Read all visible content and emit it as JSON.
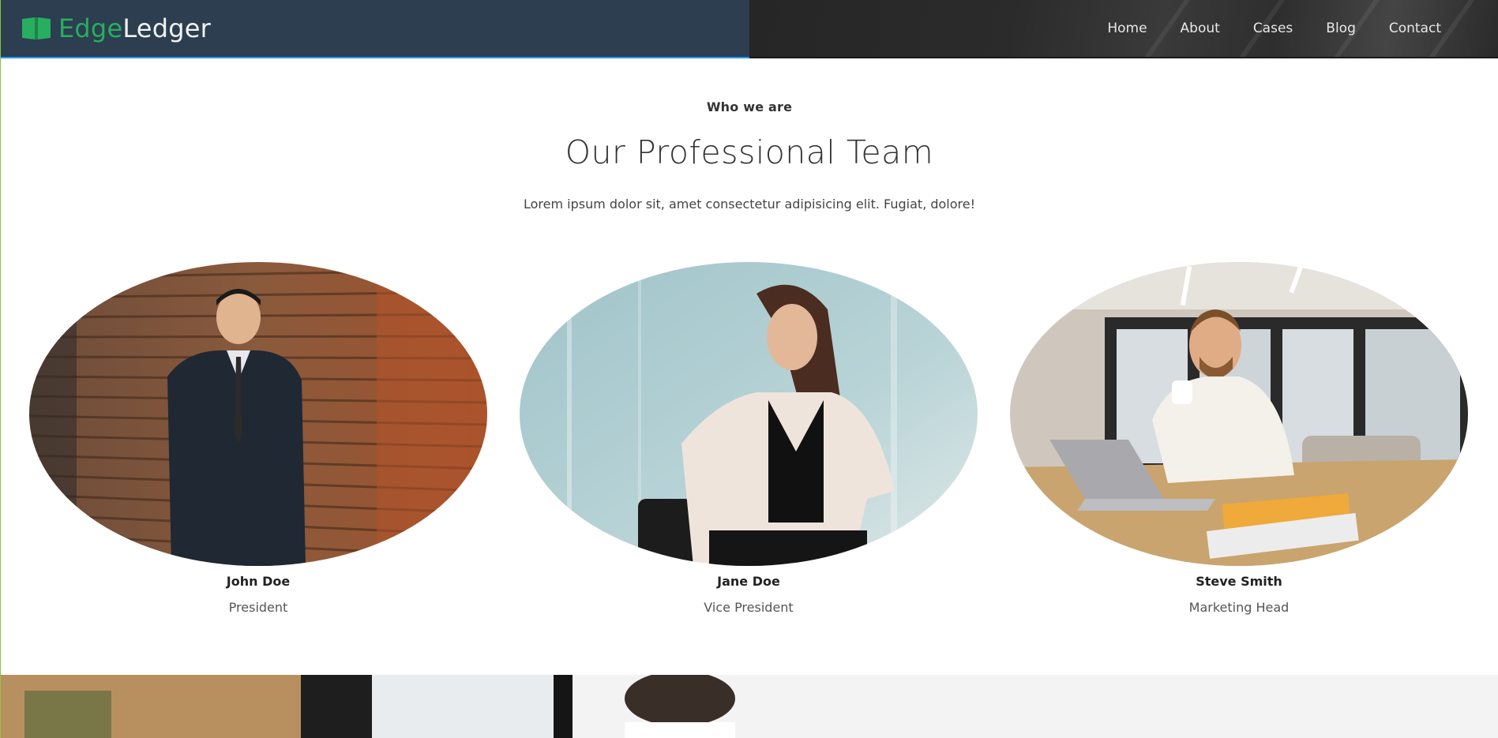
{
  "brand": {
    "name_part1": "Edge",
    "name_part2": "Ledger",
    "logo_icon": "open-book-icon",
    "accent_color": "#27ae60",
    "nav_bg_color": "#2c3e50"
  },
  "nav": {
    "links": [
      "Home",
      "About",
      "Cases",
      "Blog",
      "Contact"
    ]
  },
  "team_section": {
    "eyebrow": "Who we are",
    "title": "Our Professional Team",
    "subtitle": "Lorem ipsum dolor sit, amet consectetur adipisicing elit. Fugiat, dolore!",
    "members": [
      {
        "name": "John Doe",
        "role": "President"
      },
      {
        "name": "Jane Doe",
        "role": "Vice President"
      },
      {
        "name": "Steve Smith",
        "role": "Marketing Head"
      }
    ]
  }
}
